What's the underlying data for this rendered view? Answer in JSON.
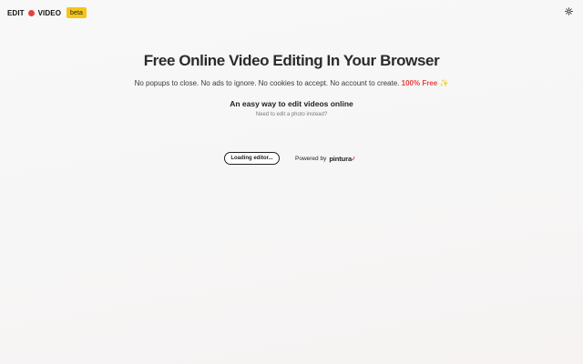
{
  "header": {
    "logo_left": "EDIT",
    "logo_right": "VIDEO",
    "badge": "beta",
    "theme_icon": "sun-icon"
  },
  "hero": {
    "title": "Free Online Video Editing In Your Browser",
    "subtitle": "No popups to close. No ads to ignore. No cookies to accept. No account to create.",
    "free_label": "100% Free",
    "sparkle": "✨",
    "tagline": "An easy way to edit videos online",
    "photo_link": "Need to edit a photo instead?"
  },
  "editor": {
    "loading_label": "Loading editor...",
    "powered_by": "Powered by",
    "brand": "pintura"
  },
  "colors": {
    "accent": "#e8413c",
    "badge": "#f5c518"
  }
}
